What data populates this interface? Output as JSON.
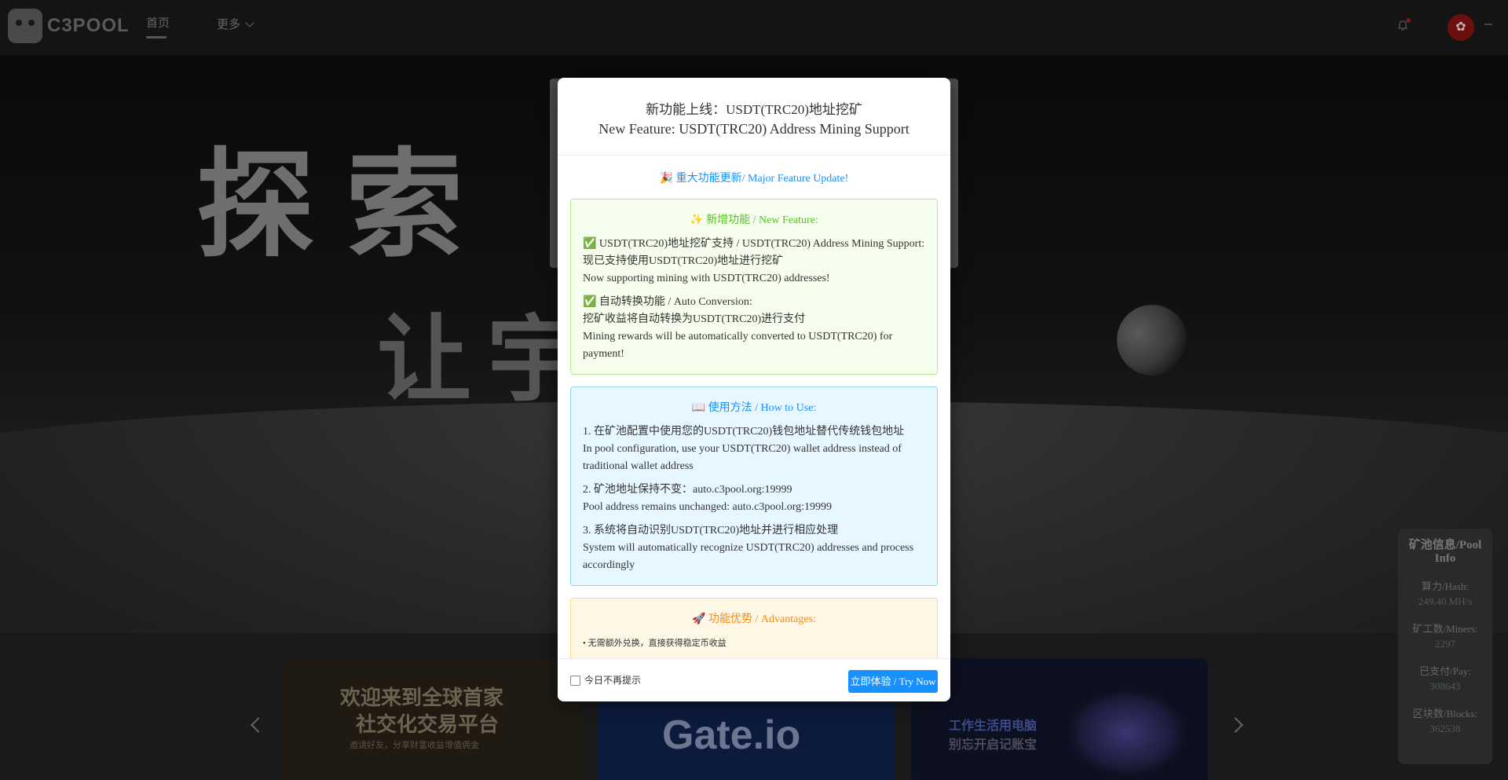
{
  "header": {
    "logo_text": "C3POOL",
    "nav_home": "首页",
    "nav_more": "更多",
    "flag_glyph": "✿"
  },
  "hero": {
    "line1": "探索",
    "line2": "让宇宙"
  },
  "banners": [
    {
      "line1": "欢迎来到全球首家",
      "line2": "社交化交易平台",
      "line3": "邀请好友，分享财富收益增值佣金"
    },
    {
      "logo": "Gate.io"
    },
    {
      "line1": "工作生活用电脑",
      "line2": "别忘开启记账宝"
    }
  ],
  "pool_info": {
    "title": "矿池信息/Pool Info",
    "hash_label": "算力/Hash:",
    "hash_value": "249.40 MH/s",
    "miners_label": "矿工数/Miners:",
    "miners_value": "2297",
    "pay_label": "已支付/Pay:",
    "pay_value": "308643",
    "blocks_label": "区块数/Blocks:",
    "blocks_value": "362538"
  },
  "modal": {
    "title_zh": "新功能上线：USDT(TRC20)地址挖矿",
    "title_en": "New Feature: USDT(TRC20) Address Mining Support",
    "major": "🎉 重大功能更新/ Major Feature Update!",
    "new_feature": {
      "title": "✨ 新增功能 / New Feature:",
      "item1_head": "✅ USDT(TRC20)地址挖矿支持 / USDT(TRC20) Address Mining Support:",
      "item1_zh": "现已支持使用USDT(TRC20)地址进行挖矿",
      "item1_en": "Now supporting mining with USDT(TRC20) addresses!",
      "item2_head": "✅ 自动转换功能 / Auto Conversion:",
      "item2_zh": "挖矿收益将自动转换为USDT(TRC20)进行支付",
      "item2_en": "Mining rewards will be automatically converted to USDT(TRC20) for payment!"
    },
    "how_to": {
      "title": "📖 使用方法 / How to Use:",
      "step1_zh": "1. 在矿池配置中使用您的USDT(TRC20)钱包地址替代传统钱包地址",
      "step1_en": "In pool configuration, use your USDT(TRC20) wallet address instead of traditional wallet address",
      "step2_zh": "2. 矿池地址保持不变：auto.c3pool.org:19999",
      "step2_en": "Pool address remains unchanged: auto.c3pool.org:19999",
      "step3_zh": "3. 系统将自动识别USDT(TRC20)地址并进行相应处理",
      "step3_en": "System will automatically recognize USDT(TRC20) addresses and process accordingly"
    },
    "advantages": {
      "title": "🚀 功能优势 / Advantages:",
      "item1": "• 无需额外兑换，直接获得稳定币收益"
    },
    "footer": {
      "checkbox_label": "今日不再提示",
      "try_button": "立即体验 / Try Now"
    }
  }
}
